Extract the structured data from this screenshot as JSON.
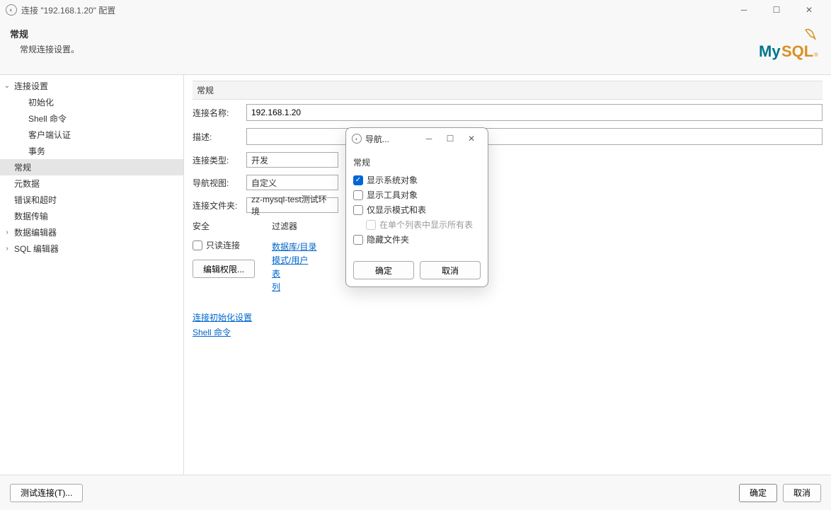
{
  "titlebar": {
    "title": "连接 \"192.168.1.20\" 配置"
  },
  "header": {
    "title": "常规",
    "subtitle": "常规连接设置。",
    "logo_text": "MySQL"
  },
  "sidebar": {
    "items": [
      {
        "label": "连接设置",
        "expandable": true,
        "expanded": true,
        "level": 0
      },
      {
        "label": "初始化",
        "level": 1
      },
      {
        "label": "Shell 命令",
        "level": 1
      },
      {
        "label": "客户端认证",
        "level": 1
      },
      {
        "label": "事务",
        "level": 1
      },
      {
        "label": "常规",
        "level": 0,
        "selected": true
      },
      {
        "label": "元数据",
        "level": 0
      },
      {
        "label": "错误和超时",
        "level": 0
      },
      {
        "label": "数据传输",
        "level": 0
      },
      {
        "label": "数据编辑器",
        "expandable": true,
        "expanded": false,
        "level": 0
      },
      {
        "label": "SQL 编辑器",
        "expandable": true,
        "expanded": false,
        "level": 0
      }
    ]
  },
  "form": {
    "group_title": "常规",
    "name_label": "连接名称:",
    "name_value": "192.168.1.20",
    "desc_label": "描述:",
    "desc_value": "",
    "type_label": "连接类型:",
    "type_value": "开发",
    "navview_label": "导航视图:",
    "navview_value": "自定义",
    "folder_label": "连接文件夹:",
    "folder_value": "zz-mysql-test测试环境"
  },
  "columns": {
    "security_title": "安全",
    "readonly_label": "只读连接",
    "edit_perm_button": "编辑权限...",
    "filter_title": "过滤器",
    "filter_links": [
      "数据库/目录",
      "模式/用户",
      "表",
      "列"
    ]
  },
  "links": {
    "init_settings": "连接初始化设置",
    "shell_cmd": "Shell 命令"
  },
  "footer": {
    "test": "测试连接(T)...",
    "ok": "确定",
    "cancel": "取消"
  },
  "modal": {
    "title": "导航...",
    "group": "常规",
    "options": [
      {
        "label": "显示系统对象",
        "checked": true,
        "indent": false,
        "disabled": false
      },
      {
        "label": "显示工具对象",
        "checked": false,
        "indent": false,
        "disabled": false
      },
      {
        "label": "仅显示模式和表",
        "checked": false,
        "indent": false,
        "disabled": false
      },
      {
        "label": "在单个列表中显示所有表",
        "checked": false,
        "indent": true,
        "disabled": true
      },
      {
        "label": "隐藏文件夹",
        "checked": false,
        "indent": false,
        "disabled": false
      }
    ],
    "ok": "确定",
    "cancel": "取消"
  }
}
